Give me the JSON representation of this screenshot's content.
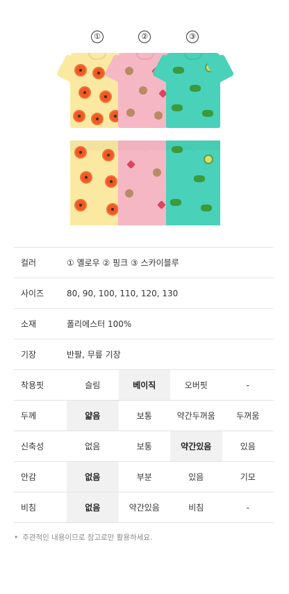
{
  "product": {
    "variant_markers": [
      "①",
      "②",
      "③"
    ],
    "variants": [
      "yellow",
      "pink",
      "sky-blue"
    ]
  },
  "spec": {
    "rows": [
      {
        "label": "컬러",
        "value": "① 옐로우 ② 핑크 ③ 스카이블루"
      },
      {
        "label": "사이즈",
        "value": "80,  90,  100, 110,  120,  130"
      },
      {
        "label": "소재",
        "value": "폴리에스터 100%"
      },
      {
        "label": "기장",
        "value": "반팔, 무릎 기장"
      }
    ],
    "rating_rows": [
      {
        "label": "착용핏",
        "options": [
          "슬림",
          "베이직",
          "오버핏",
          "-"
        ],
        "selected": 1
      },
      {
        "label": "두께",
        "options": [
          "얇음",
          "보통",
          "약간두꺼움",
          "두꺼움"
        ],
        "selected": 0
      },
      {
        "label": "신축성",
        "options": [
          "없음",
          "보통",
          "약간있음",
          "있음"
        ],
        "selected": 2
      },
      {
        "label": "안감",
        "options": [
          "없음",
          "부분",
          "있음",
          "기모"
        ],
        "selected": 0
      },
      {
        "label": "비침",
        "options": [
          "없음",
          "약간있음",
          "비침",
          "-"
        ],
        "selected": 0
      }
    ]
  },
  "note": {
    "bullet": "•",
    "text": "주관적인 내용이므로 참고로만 활용하세요."
  },
  "colors": {
    "yellow": "#fbe9a2",
    "pink": "#f6b7c4",
    "sky_blue": "#49d1b9",
    "selected_bg": "#f1f1f1",
    "border": "#e3e3e3"
  }
}
